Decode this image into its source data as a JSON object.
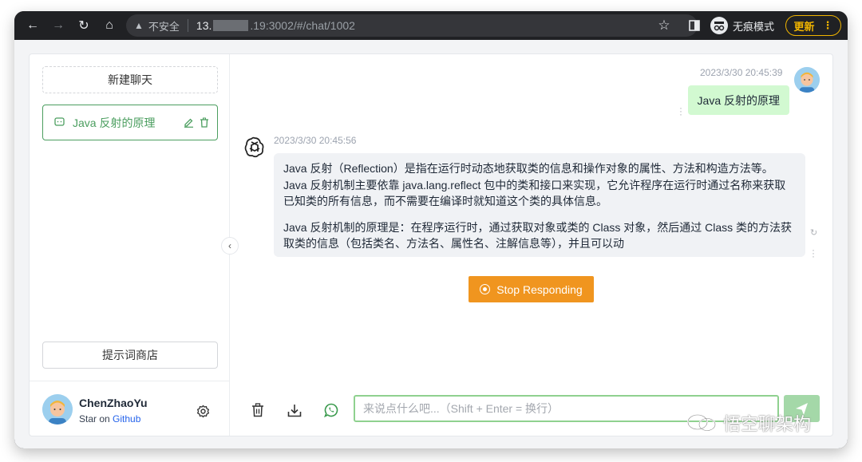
{
  "browser": {
    "back_label": "←",
    "forward_label": "→",
    "reload_label": "↻",
    "home_label": "⌂",
    "insecure_label": "不安全",
    "url_prefix": "13.",
    "url_suffix": ".19:3002/#/chat/1002",
    "incognito_label": "无痕模式",
    "update_label": "更新",
    "menu_label": "⋮"
  },
  "sidebar": {
    "new_chat_label": "新建聊天",
    "conversations": [
      {
        "title": "Java 反射的原理"
      }
    ],
    "prompt_store_label": "提示词商店",
    "user": {
      "name": "ChenZhaoYu",
      "sub_prefix": "Star on ",
      "sub_link": "Github"
    }
  },
  "chat": {
    "user_message": {
      "time": "2023/3/30 20:45:39",
      "text": "Java 反射的原理"
    },
    "assistant_message": {
      "time": "2023/3/30 20:45:56",
      "paragraphs": [
        "Java 反射（Reflection）是指在运行时动态地获取类的信息和操作对象的属性、方法和构造方法等。Java 反射机制主要依靠 java.lang.reflect 包中的类和接口来实现，它允许程序在运行时通过名称来获取已知类的所有信息，而不需要在编译时就知道这个类的具体信息。",
        "Java 反射机制的原理是：在程序运行时，通过获取对象或类的 Class 对象，然后通过 Class 类的方法获取类的信息（包括类名、方法名、属性名、注解信息等），并且可以动"
      ]
    },
    "stop_label": "Stop Responding",
    "input_placeholder": "来说点什么吧...（Shift + Enter = 换行）"
  },
  "watermark": {
    "text": "悟空聊架构"
  },
  "colors": {
    "accent": "#4b9e5f",
    "stop": "#f0951f",
    "user_bubble": "#d2f9d1"
  }
}
